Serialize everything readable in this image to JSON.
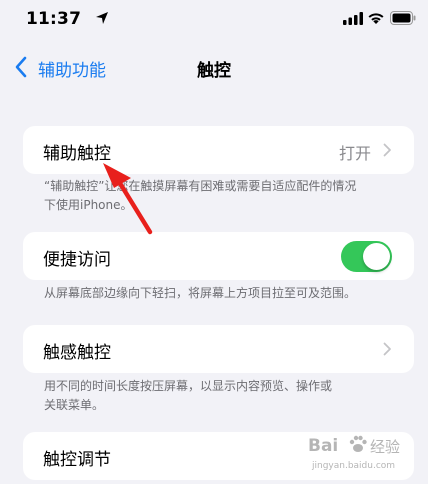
{
  "status": {
    "time": "11:37"
  },
  "nav": {
    "back_label": "辅助功能",
    "title": "触控"
  },
  "rows": {
    "assistive_touch": {
      "label": "辅助触控",
      "value": "打开"
    },
    "reachability": {
      "label": "便捷访问",
      "toggle_on": true
    },
    "haptic_touch": {
      "label": "触感触控"
    },
    "touch_accommodations": {
      "label": "触控调节"
    }
  },
  "footnotes": {
    "assistive_touch_line1": "“辅助触控”让您在触摸屏幕有困难或需要自适应配件的情况",
    "assistive_touch_line2": "下使用iPhone。",
    "reachability": "从屏幕底部边缘向下轻扫，将屏幕上方项目拉至可及范围。",
    "haptic_line1": "用不同的时间长度按压屏幕，以显示内容预览、操作或",
    "haptic_line2": "关联菜单。"
  },
  "watermark": {
    "brand": "Bai",
    "brand2": "经验",
    "url": "jingyan.baidu.com"
  },
  "colors": {
    "accent": "#1a7cf0",
    "toggle_on": "#34c759",
    "annotation": "#e8201c"
  }
}
